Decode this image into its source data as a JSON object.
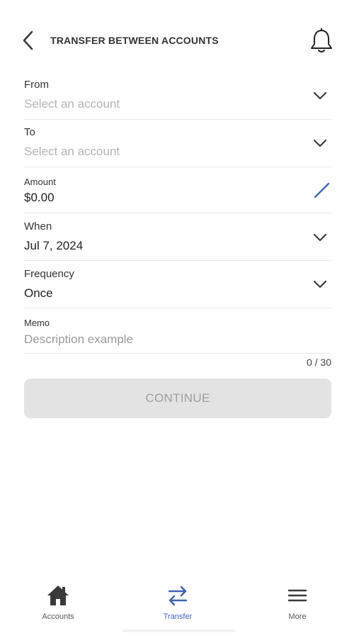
{
  "header": {
    "title": "TRANSFER BETWEEN ACCOUNTS"
  },
  "form": {
    "from": {
      "label": "From",
      "placeholder": "Select an account"
    },
    "to": {
      "label": "To",
      "placeholder": "Select an account"
    },
    "amount": {
      "label": "Amount",
      "value": "$0.00"
    },
    "when": {
      "label": "When",
      "value": "Jul 7, 2024"
    },
    "frequency": {
      "label": "Frequency",
      "value": "Once"
    },
    "memo": {
      "label": "Memo",
      "placeholder": "Description example",
      "counter": "0 / 30"
    }
  },
  "continue_label": "CONTINUE",
  "nav": {
    "items": [
      {
        "label": "Accounts",
        "icon": "home-icon",
        "active": false
      },
      {
        "label": "Transfer",
        "icon": "transfer-arrows-icon",
        "active": true
      },
      {
        "label": "More",
        "icon": "menu-icon",
        "active": false
      }
    ]
  },
  "colors": {
    "accent": "#3d63b8",
    "icon_dark": "#3a3a3a",
    "button_disabled_bg": "#e3e3e3",
    "button_disabled_text": "#9e9e9e",
    "placeholder": "#b4b4b4",
    "divider": "#e8e8e8"
  }
}
